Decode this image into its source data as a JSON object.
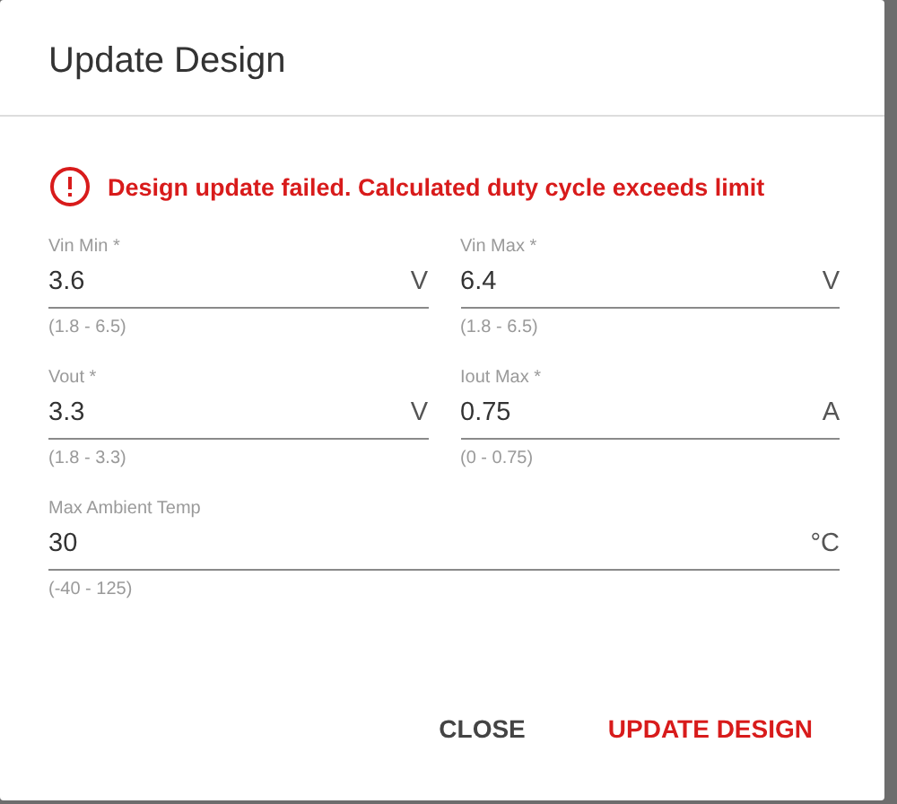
{
  "dialog": {
    "title": "Update Design",
    "error": {
      "message": "Design update failed. Calculated duty cycle exceeds limit"
    },
    "fields": [
      {
        "label": "Vin Min *",
        "value": "3.6",
        "unit": "V",
        "hint": "(1.8 - 6.5)",
        "wide": false
      },
      {
        "label": "Vin Max *",
        "value": "6.4",
        "unit": "V",
        "hint": "(1.8 - 6.5)",
        "wide": false
      },
      {
        "label": "Vout *",
        "value": "3.3",
        "unit": "V",
        "hint": "(1.8 - 3.3)",
        "wide": false
      },
      {
        "label": "Iout Max *",
        "value": "0.75",
        "unit": "A",
        "hint": "(0 - 0.75)",
        "wide": false
      },
      {
        "label": "Max Ambient Temp",
        "value": "30",
        "unit": "°C",
        "hint": "(-40 - 125)",
        "wide": true
      }
    ],
    "buttons": [
      {
        "label": "CLOSE",
        "kind": "secondary"
      },
      {
        "label": "UPDATE DESIGN",
        "kind": "primary"
      }
    ]
  }
}
